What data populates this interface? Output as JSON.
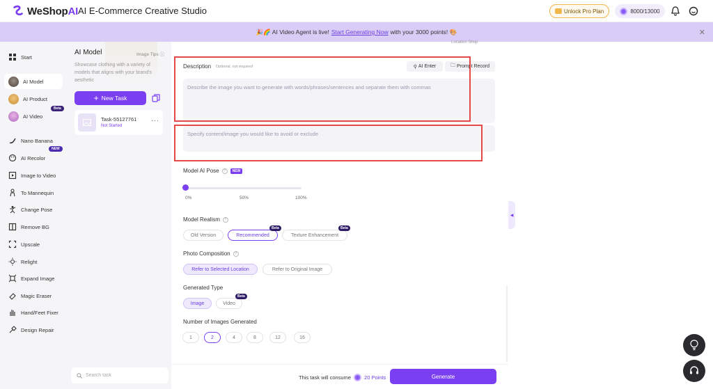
{
  "header": {
    "logo_text_a": "WeShop",
    "logo_text_b": "AI",
    "app_title": "AI E-Commerce Creative Studio",
    "unlock_label": "Unlock Pro Plan",
    "points": "8000/13000"
  },
  "banner": {
    "prefix": "🎉🌈 AI Video Agent is live!",
    "link": "Start Generating Now",
    "suffix": "with your 3000 points! 🎨",
    "close": "✕"
  },
  "nav": {
    "items": [
      {
        "label": "Start",
        "icon": "grid-icon"
      },
      {
        "label": "AI Model",
        "icon": "model-avatar"
      },
      {
        "label": "AI Product",
        "icon": "product-avatar"
      },
      {
        "label": "AI Video",
        "icon": "video-avatar",
        "badge": "Beta"
      },
      {
        "label": "Nano Banana",
        "icon": "banana-icon"
      },
      {
        "label": "AI Recolor",
        "icon": "palette-icon",
        "badge": "NEW"
      },
      {
        "label": "Image to Video",
        "icon": "film-icon"
      },
      {
        "label": "To Mannequin",
        "icon": "mannequin-icon"
      },
      {
        "label": "Change Pose",
        "icon": "pose-icon"
      },
      {
        "label": "Remove BG",
        "icon": "remove-bg-icon"
      },
      {
        "label": "Upscale",
        "icon": "upscale-icon"
      },
      {
        "label": "Relight",
        "icon": "relight-icon"
      },
      {
        "label": "Expand Image",
        "icon": "expand-icon"
      },
      {
        "label": "Magic Eraser",
        "icon": "eraser-icon"
      },
      {
        "label": "Hand/Feet Fixer",
        "icon": "hand-icon"
      },
      {
        "label": "Design Repair",
        "icon": "repair-icon"
      }
    ]
  },
  "task_panel": {
    "title": "AI Model",
    "tips": "Image Tips",
    "tips_icon": "ⓘ",
    "description": "Showcase clothing with a variety of models that aligns with your brand's aesthetic",
    "new_task": "New Task",
    "task_name": "Task-55127761",
    "task_status": "Not Started",
    "task_more": "···",
    "search_placeholder": "Search task"
  },
  "form": {
    "location_shop": "Location Shop",
    "description_label": "Description",
    "description_optional": "Optional, not required",
    "ai_enter": "AI Enter",
    "prompt_record": "Prompt Record",
    "description_placeholder": "Describe the image you want to generate with words/phrases/sentences and separate them with commas",
    "negative_placeholder": "Specify content/image you would like to avoid or exclude",
    "pose_label": "Model AI Pose",
    "pose_new": "NEW",
    "pose_value": 0,
    "pose_ticks": [
      "0%",
      "50%",
      "100%"
    ],
    "realism_label": "Model Realism",
    "realism_options": [
      "Old Version",
      "Recommended",
      "Texture Enhancement"
    ],
    "realism_selected": "Recommended",
    "beta": "Beta",
    "composition_label": "Photo Composition",
    "composition_options": [
      "Refer to Selected Location",
      "Refer to Original Image"
    ],
    "type_label": "Generated Type",
    "type_options": [
      "Image",
      "Video"
    ],
    "count_label": "Number of Images Generated",
    "count_options": [
      "1",
      "2",
      "4",
      "8",
      "12",
      "16"
    ],
    "count_selected": "2"
  },
  "footer": {
    "consume_text": "This task will consume",
    "points": "20 Points",
    "generate": "Generate"
  },
  "colors": {
    "accent": "#7b3ff2",
    "banner_bg": "#d9cdf7",
    "highlight_box": "#e64848"
  }
}
